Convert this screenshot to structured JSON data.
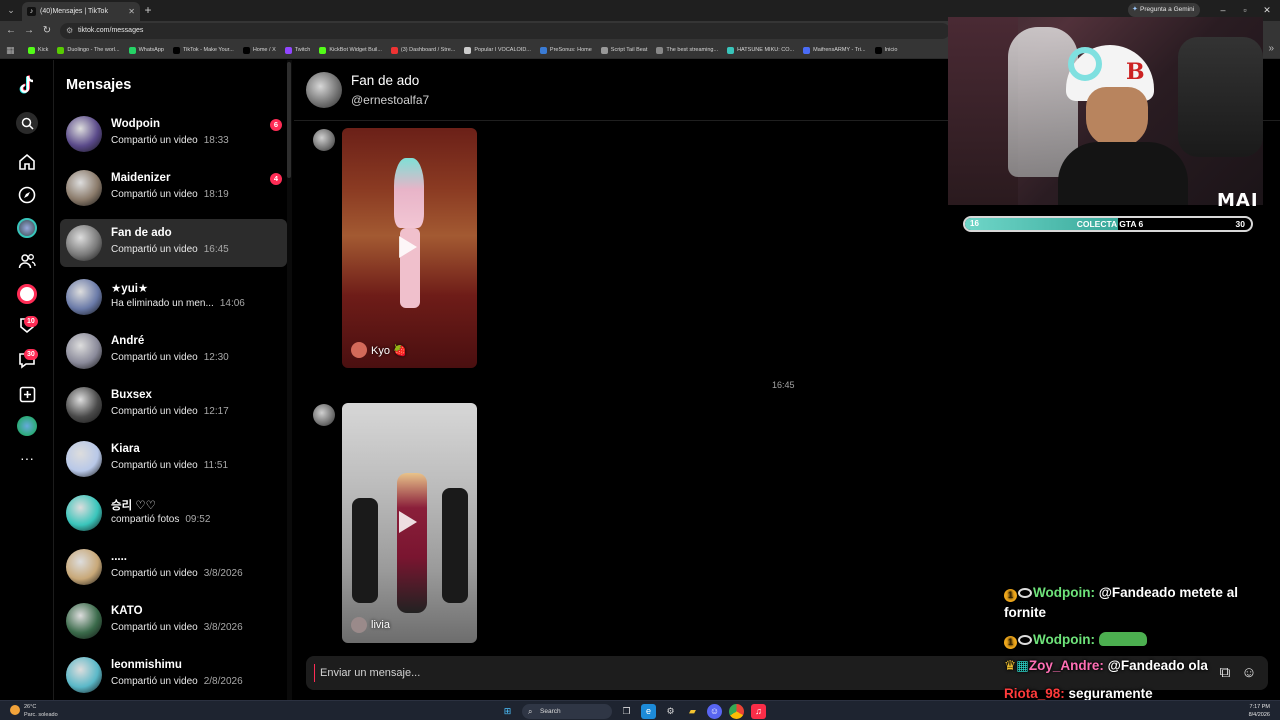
{
  "browser": {
    "tab_title": "(40)Mensajes | TikTok",
    "url": "tiktok.com/messages",
    "gemini_label": "Pregunta a Gemini",
    "bookmarks": [
      {
        "label": "Kick",
        "color": "#53fc18"
      },
      {
        "label": "Duolingo - The worl...",
        "color": "#58cc02"
      },
      {
        "label": "WhatsApp",
        "color": "#25d366"
      },
      {
        "label": "TikTok - Make Your...",
        "color": "#000000"
      },
      {
        "label": "Home / X",
        "color": "#000000"
      },
      {
        "label": "Twitch",
        "color": "#9146ff"
      },
      {
        "label": "KickBot Widget Buil...",
        "color": "#53fc18"
      },
      {
        "label": "(3) Dashboard / Stre...",
        "color": "#e33"
      },
      {
        "label": "Popular I VOCALOID...",
        "color": "#ccc"
      },
      {
        "label": "PreSonus: Home",
        "color": "#3a7bd5"
      },
      {
        "label": "Script Tail Beat",
        "color": "#999"
      },
      {
        "label": "The best streaming...",
        "color": "#888"
      },
      {
        "label": "HATSUNE MIKU: CO...",
        "color": "#39c5bb"
      },
      {
        "label": "MaifrensARMY - Tri...",
        "color": "#4a6cf7"
      },
      {
        "label": "Inicio",
        "color": "#000000"
      }
    ]
  },
  "rail": {
    "notifications_badge": "10",
    "inbox_badge": "30"
  },
  "conversations": {
    "title": "Mensajes",
    "items": [
      {
        "name": "Wodpoin",
        "preview": "Compartió un video",
        "time": "18:33",
        "unread": "6",
        "color": "#5a4a8a"
      },
      {
        "name": "Maidenizer",
        "preview": "Compartió un video",
        "time": "18:19",
        "unread": "4",
        "color": "#8a7a6a"
      },
      {
        "name": "Fan de ado",
        "preview": "Compartió un video",
        "time": "16:45",
        "unread": "",
        "color": "#7a7a7a"
      },
      {
        "name": "★yui★",
        "preview": "Ha eliminado un men...",
        "time": "14:06",
        "unread": "",
        "color": "#6a7aa8"
      },
      {
        "name": "André",
        "preview": "Compartió un video",
        "time": "12:30",
        "unread": "",
        "color": "#8a8a9a"
      },
      {
        "name": "Buxsex",
        "preview": "Compartió un video",
        "time": "12:17",
        "unread": "",
        "color": "#4a4a4a"
      },
      {
        "name": "Kiara",
        "preview": "Compartió un video",
        "time": "11:51",
        "unread": "",
        "color": "#b8c8e8"
      },
      {
        "name": "승리 ♡♡",
        "preview": "compartió fotos",
        "time": "09:52",
        "unread": "",
        "color": "#39c5bb"
      },
      {
        "name": ".....",
        "preview": "Compartió un video",
        "time": "3/8/2026",
        "unread": "",
        "color": "#c8a878"
      },
      {
        "name": "KATO",
        "preview": "Compartió un video",
        "time": "3/8/2026",
        "unread": "",
        "color": "#3a6a4a"
      },
      {
        "name": "leonmishimu",
        "preview": "Compartió un video",
        "time": "2/8/2026",
        "unread": "",
        "color": "#5ab8c8"
      }
    ]
  },
  "chat": {
    "name": "Fan de ado",
    "handle": "@ernestoalfa7",
    "messages": [
      {
        "author": "Kyo 🍓"
      },
      {
        "author": "livia"
      }
    ],
    "timestamp": "16:45",
    "input_placeholder": "Enviar un mensaje..."
  },
  "overlay": {
    "logo": "MAI",
    "goal": {
      "start": "16",
      "label": "COLECTA GTA 6",
      "end": "30",
      "current": 16,
      "target": 30
    },
    "chat": [
      {
        "badge": "1",
        "user": "Wodpoin:",
        "user_color": "#6ee37a",
        "text": "@Fandeado metete al fornite"
      },
      {
        "badge": "1",
        "user": "Wodpoin:",
        "user_color": "#6ee37a",
        "text": ""
      },
      {
        "badge": "",
        "user": "Zoy_Andre:",
        "user_color": "#ff6fb5",
        "text": "@Fandeado ola"
      },
      {
        "badge": "",
        "user": "Riota_98:",
        "user_color": "#ff3b3b",
        "text": "seguramente"
      }
    ]
  },
  "taskbar": {
    "weather_temp": "26°C",
    "weather_desc": "Parc. soleado",
    "search": "Search",
    "time": "7:17 PM",
    "date": "8/4/2026"
  }
}
